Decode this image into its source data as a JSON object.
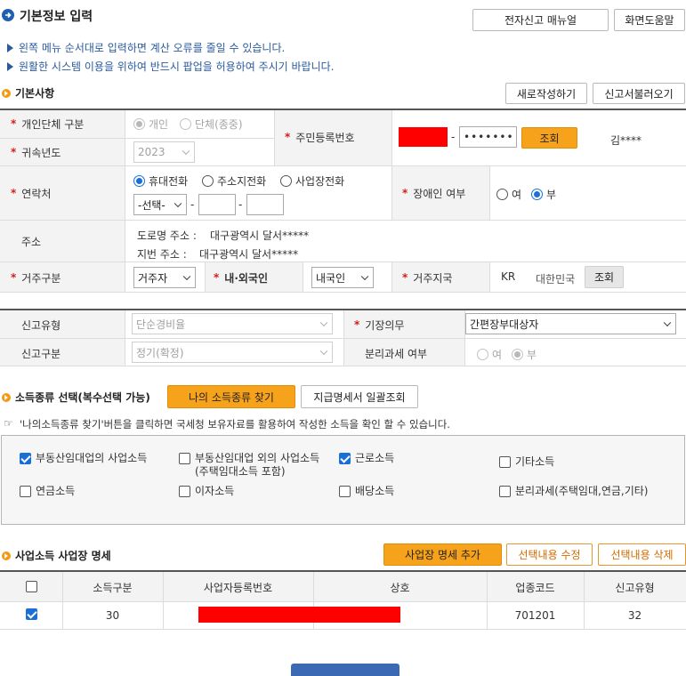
{
  "page": {
    "title": "기본정보 입력",
    "manual_button": "전자신고 매뉴얼",
    "help_button": "화면도움말",
    "info": [
      "왼쪽 메뉴 순서대로 입력하면 계산 오류를 줄일 수 있습니다.",
      "원활한 시스템 이용을 위하여 반드시 팝업을 허용하여 주시기 바랍니다."
    ]
  },
  "basic": {
    "title": "기본사항",
    "new_button": "새로작성하기",
    "load_button": "신고서불러오기",
    "person_type_label": "개인단체 구분",
    "person_type_options": [
      "개인",
      "단체(종중)"
    ],
    "year_label": "귀속년도",
    "year_value": "2023",
    "rrn_label": "주민등록번호",
    "rrn_dash": "-",
    "rrn_back": "•••••••",
    "lookup_button": "조회",
    "name_value": "김****",
    "contact_label": "연락처",
    "phone_options": [
      "휴대전화",
      "주소지전화",
      "사업장전화"
    ],
    "phone_select": "-선택-",
    "phone_dash": "-",
    "disabled_label": "장애인 여부",
    "disabled_options": [
      "여",
      "부"
    ],
    "address_label": "주소",
    "road_address_label": "도로명 주소 :",
    "road_address": "대구광역시 달서*****",
    "lot_address_label": "지번 주소 :",
    "lot_address": "대구광역시 달서*****",
    "residence_label": "거주구분",
    "residence_value": "거주자",
    "nationality_label": "내·외국인",
    "nationality_value": "내국인",
    "country_label": "거주지국",
    "country_code": "KR",
    "country_name": "대한민국",
    "country_button": "조회"
  },
  "report": {
    "type_label": "신고유형",
    "type_value": "단순경비율",
    "bookkeeping_label": "기장의무",
    "bookkeeping_value": "간편장부대상자",
    "kind_label": "신고구분",
    "kind_value": "정기(확정)",
    "separate_label": "분리과세 여부",
    "separate_options": [
      "여",
      "부"
    ]
  },
  "income": {
    "title": "소득종류 선택(복수선택 가능)",
    "find_button": "나의 소득종류 찾기",
    "bulk_button": "지급명세서 일괄조회",
    "hint_icon": "pointing-hand-icon",
    "hint": "'나의소득종류 찾기'버튼을 클릭하면 국세청 보유자료를 활용하여 작성한 소득을 확인 할 수 있습니다.",
    "items": [
      {
        "label": "부동산임대업의 사업소득",
        "checked": true
      },
      {
        "label": "부동산임대업 외의 사업소득",
        "sub": "(주택임대소득 포함)",
        "checked": false
      },
      {
        "label": "근로소득",
        "checked": true
      },
      {
        "label": "기타소득",
        "checked": false
      },
      {
        "label": "연금소득",
        "checked": false
      },
      {
        "label": "이자소득",
        "checked": false
      },
      {
        "label": "배당소득",
        "checked": false
      },
      {
        "label": "분리과세(주택임대,연금,기타)",
        "checked": false
      }
    ]
  },
  "business": {
    "title": "사업소득 사업장 명세",
    "add_button": "사업장 명세 추가",
    "edit_button": "선택내용 수정",
    "delete_button": "선택내용 삭제",
    "columns": [
      "소득구분",
      "사업자등록번호",
      "상호",
      "업종코드",
      "신고유형"
    ],
    "rows": [
      {
        "checked": true,
        "income_type": "30",
        "business_number": "",
        "trade_name": "",
        "industry_code": "701201",
        "report_type": "32"
      }
    ]
  },
  "colors": {
    "accent_orange": "#f7a21b",
    "info_blue": "#2a5b9c",
    "required_red": "#d21c1c",
    "check_blue": "#1a6fd6"
  }
}
